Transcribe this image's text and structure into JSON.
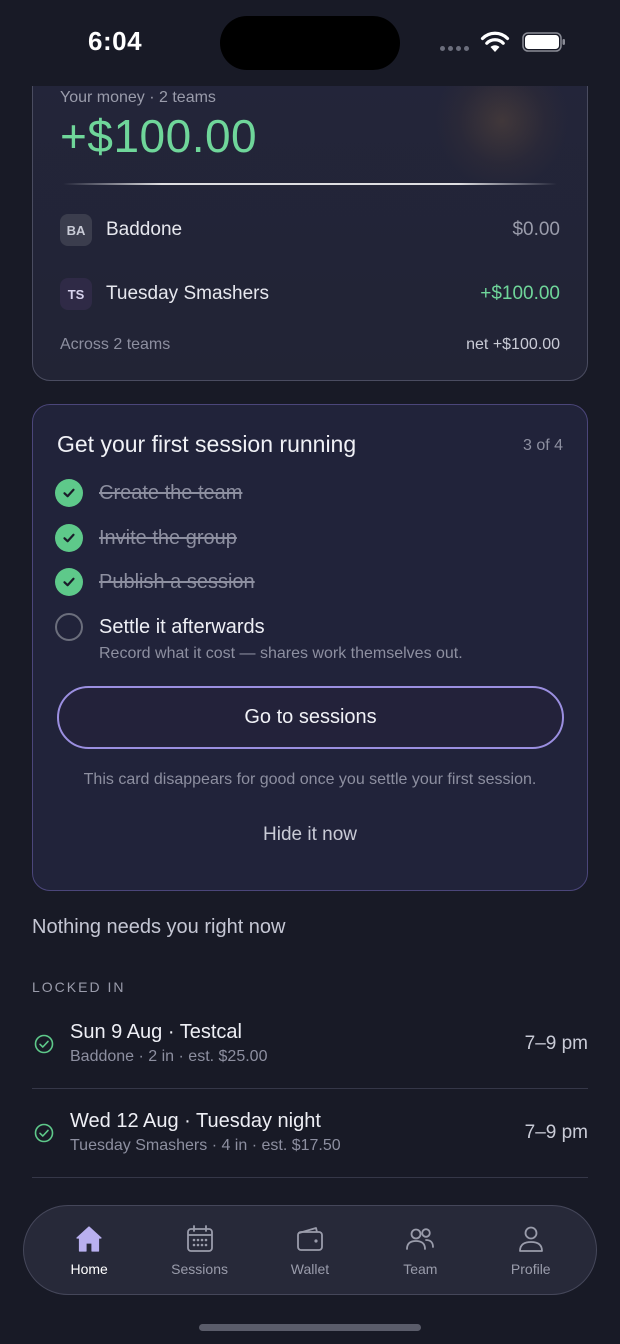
{
  "status_bar": {
    "time": "6:04"
  },
  "money": {
    "caption": "Your money · 2 teams",
    "total": "+$100.00",
    "teams": [
      {
        "initials": "BA",
        "name": "Baddone",
        "amount": "$0.00"
      },
      {
        "initials": "TS",
        "name": "Tuesday Smashers",
        "amount": "+$100.00"
      }
    ],
    "footer_left": "Across 2 teams",
    "footer_right": "net +$100.00"
  },
  "onboarding": {
    "title": "Get your first session running",
    "progress": "3 of 4",
    "steps": [
      {
        "label": "Create the team",
        "done": true
      },
      {
        "label": "Invite the group",
        "done": true
      },
      {
        "label": "Publish a session",
        "done": true
      },
      {
        "label": "Settle it afterwards",
        "done": false,
        "sub": "Record what it cost — shares work themselves out."
      }
    ],
    "button_label": "Go to sessions",
    "note": "This card disappears for good once you settle your first session.",
    "hide_label": "Hide it now"
  },
  "nothing_text": "Nothing needs you right now",
  "locked_in": {
    "header": "LOCKED IN",
    "sessions": [
      {
        "title": "Sun 9 Aug · Testcal",
        "sub": "Baddone · 2 in · est. $25.00",
        "time": "7–9 pm"
      },
      {
        "title": "Wed 12 Aug · Tuesday night",
        "sub": "Tuesday Smashers · 4 in · est. $17.50",
        "time": "7–9 pm"
      }
    ]
  },
  "tabs": [
    {
      "label": "Home",
      "icon": "home-icon",
      "active": true
    },
    {
      "label": "Sessions",
      "icon": "calendar-icon",
      "active": false
    },
    {
      "label": "Wallet",
      "icon": "wallet-icon",
      "active": false
    },
    {
      "label": "Team",
      "icon": "team-icon",
      "active": false
    },
    {
      "label": "Profile",
      "icon": "profile-icon",
      "active": false
    }
  ],
  "colors": {
    "positive": "#6fd69a",
    "accent": "#9b8fe0",
    "check": "#5ec98a",
    "background": "#181a26"
  }
}
